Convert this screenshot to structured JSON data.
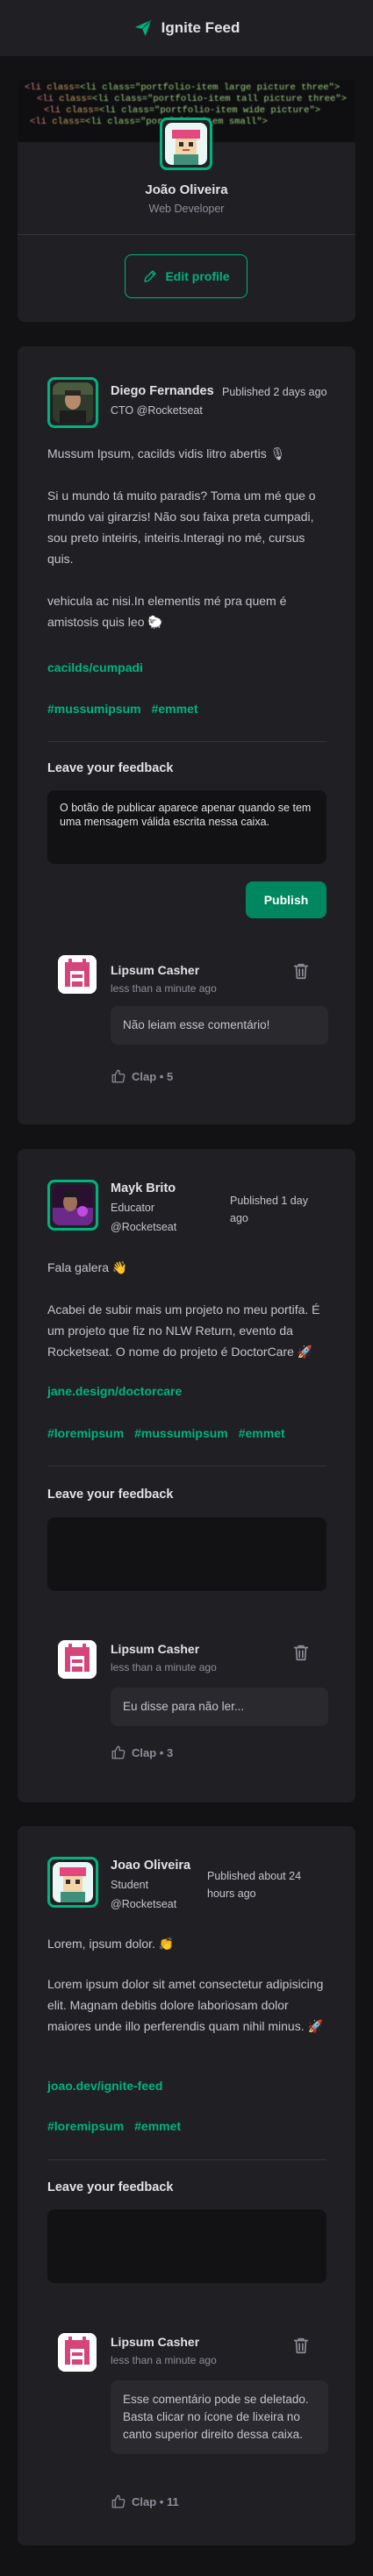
{
  "header": {
    "title": "Ignite Feed",
    "logo_icon": "paper-plane-icon"
  },
  "profile": {
    "name": "João Oliveira",
    "role": "Web Developer",
    "edit_label": "Edit profile",
    "cover_code": [
      "<li class=\"portfolio-item large picture three\">",
      "<li class=\"portfolio-item tall picture three\">",
      "<li class=\"portfolio-item wide picture\">",
      "<li class=\"portfolio-item small\">"
    ]
  },
  "posts": [
    {
      "author": {
        "name": "Diego Fernandes",
        "role": "CTO @Rocketseat"
      },
      "published": "Published 2 days ago",
      "paragraphs": [
        "Mussum Ipsum, cacilds vidis litro abertis 🎙",
        "Si u mundo tá muito paradis? Toma um mé que o mundo vai girarzis! Não sou faixa preta cumpadi, sou preto inteiris, inteiris.Interagi no mé, cursus quis.",
        "vehicula ac nisi.In elementis mé pra quem é amistosis quis leo 🐑"
      ],
      "link": "cacilds/cumpadi",
      "tags": [
        "#mussumipsum",
        "#emmet"
      ],
      "feedback_title": "Leave your feedback",
      "feedback_value": "O botão de publicar aparece apenar quando se tem uma mensagem válida escrita nessa caixa.",
      "publish_label": "Publish",
      "comment": {
        "author": "Lipsum Casher",
        "time": "less than a minute ago",
        "text": "Não leiam esse comentário!",
        "clap_label": "Clap • 5"
      }
    },
    {
      "author": {
        "name": "Mayk Brito",
        "role_line1": "Educator",
        "role_line2": "@Rocketseat"
      },
      "published_line1": "Published 1 day",
      "published_line2": "ago",
      "paragraphs": [
        "Fala galera 👋",
        "Acabei de subir mais um projeto no meu portifa. É um projeto que fiz no NLW Return, evento da Rocketseat. O nome do projeto é DoctorCare 🚀"
      ],
      "link": "jane.design/doctorcare",
      "tags": [
        "#loremipsum",
        "#mussumipsum",
        "#emmet"
      ],
      "feedback_title": "Leave your feedback",
      "comment": {
        "author": "Lipsum Casher",
        "time": "less than a minute ago",
        "text": "Eu disse para não ler...",
        "clap_label": "Clap • 3"
      }
    },
    {
      "author": {
        "name": "Joao Oliveira",
        "role_line1": "Student",
        "role_line2": "@Rocketseat"
      },
      "published_line1": "Published about 24",
      "published_line2": "hours ago",
      "paragraphs": [
        "Lorem, ipsum dolor. 👏",
        "Lorem ipsum dolor sit amet consectetur adipisicing elit. Magnam debitis dolore laboriosam dolor maiores unde illo perferendis quam nihil minus. 🚀"
      ],
      "link": "joao.dev/ignite-feed",
      "tags": [
        "#loremipsum",
        "#emmet"
      ],
      "feedback_title": "Leave your feedback",
      "comment": {
        "author": "Lipsum Casher",
        "time": "less than a minute ago",
        "text": "Esse comentário pode se deletado. Basta clicar no ícone de lixeira no canto superior direito dessa caixa.",
        "clap_label": "Clap • 11"
      }
    }
  ],
  "colors": {
    "accent": "#00b37e",
    "background": "#121214",
    "card": "#202024",
    "publish": "#00875f"
  }
}
